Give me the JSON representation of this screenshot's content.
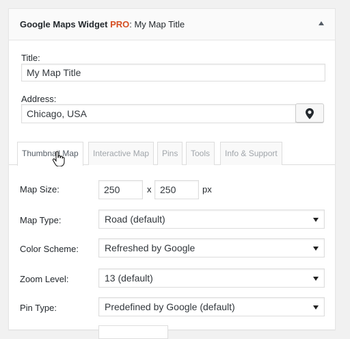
{
  "widget": {
    "title_main": "Google Maps Widget ",
    "title_pro": "PRO",
    "title_rest": ": My Map Title",
    "toggle_icon": "triangle-up-icon"
  },
  "form": {
    "title_label": "Title:",
    "title_value": "My Map Title",
    "address_label": "Address:",
    "address_value": "Chicago, USA",
    "pin_icon": "map-marker-icon"
  },
  "tabs": [
    {
      "label": "Thumbnail Map",
      "active": true
    },
    {
      "label": "Interactive Map",
      "active": false
    },
    {
      "label": "Pins",
      "active": false
    },
    {
      "label": "Tools",
      "active": false
    },
    {
      "label": "Info & Support",
      "active": false
    }
  ],
  "thumbnail": {
    "map_size_label": "Map Size:",
    "width_value": "250",
    "size_separator": "x",
    "height_value": "250",
    "size_unit": "px",
    "map_type_label": "Map Type:",
    "map_type_value": "Road (default)",
    "color_scheme_label": "Color Scheme:",
    "color_scheme_value": "Refreshed by Google",
    "zoom_label": "Zoom Level:",
    "zoom_value": "13 (default)",
    "pin_type_label": "Pin Type:",
    "pin_type_value": "Predefined by Google (default)"
  },
  "colors": {
    "pro_accent": "#d54e21",
    "header_bg": "#fafafa",
    "page_bg": "#f1f1f1"
  }
}
